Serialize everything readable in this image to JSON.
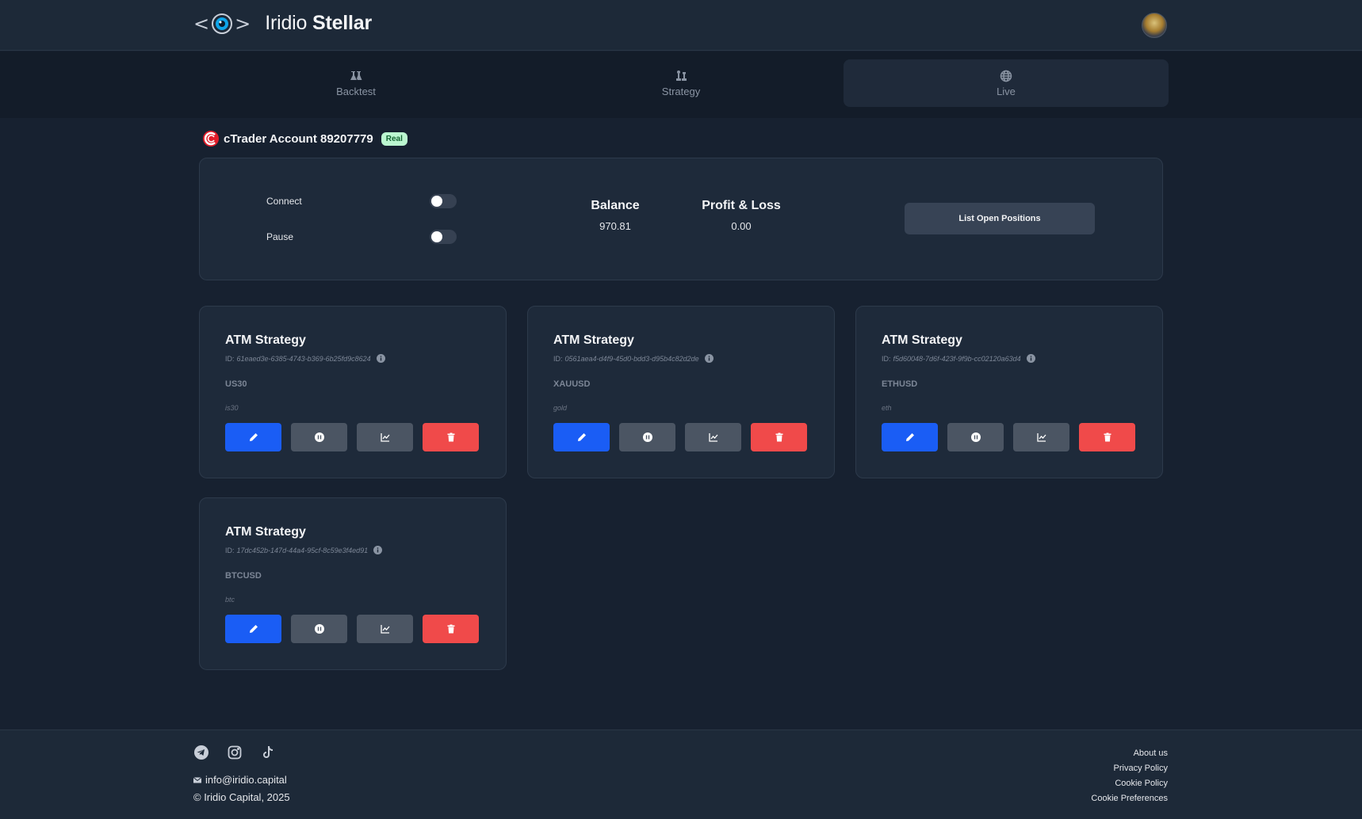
{
  "header": {
    "brand_light": "Iridio",
    "brand_bold": "Stellar",
    "logo_left": "<",
    "logo_right": ">"
  },
  "tabs": [
    {
      "label": "Backtest",
      "icon": "flask-icon",
      "active": false
    },
    {
      "label": "Strategy",
      "icon": "chess-icon",
      "active": false
    },
    {
      "label": "Live",
      "icon": "globe-icon",
      "active": true
    }
  ],
  "account": {
    "title": "cTrader Account 89207779",
    "badge": "Real",
    "connect_label": "Connect",
    "pause_label": "Pause",
    "balance_label": "Balance",
    "balance_value": "970.81",
    "pnl_label": "Profit & Loss",
    "pnl_value": "0.00",
    "list_button": "List Open Positions"
  },
  "strategies": [
    {
      "name": "ATM Strategy",
      "id_label": "ID:",
      "id": "61eaed3e-6385-4743-b369-6b25fd9c8624",
      "symbol": "US30",
      "description": "is30"
    },
    {
      "name": "ATM Strategy",
      "id_label": "ID:",
      "id": "0561aea4-d4f9-45d0-bdd3-d95b4c82d2de",
      "symbol": "XAUUSD",
      "description": "gold"
    },
    {
      "name": "ATM Strategy",
      "id_label": "ID:",
      "id": "f5d60048-7d6f-423f-9f9b-cc02120a63d4",
      "symbol": "ETHUSD",
      "description": "eth"
    },
    {
      "name": "ATM Strategy",
      "id_label": "ID:",
      "id": "17dc452b-147d-44a4-95cf-8c59e3f4ed91",
      "symbol": "BTCUSD",
      "description": "btc"
    }
  ],
  "footer": {
    "email": "info@iridio.capital",
    "copyright": "© Iridio Capital, 2025",
    "links": [
      "About us",
      "Privacy Policy",
      "Cookie Policy",
      "Cookie Preferences"
    ]
  },
  "colors": {
    "background": "#172130",
    "card": "#1e2a3a",
    "edit_button": "#1a5df5",
    "neutral_button": "#4b5563",
    "delete_button": "#f04a4a",
    "badge_bg": "#bbf7d0"
  }
}
